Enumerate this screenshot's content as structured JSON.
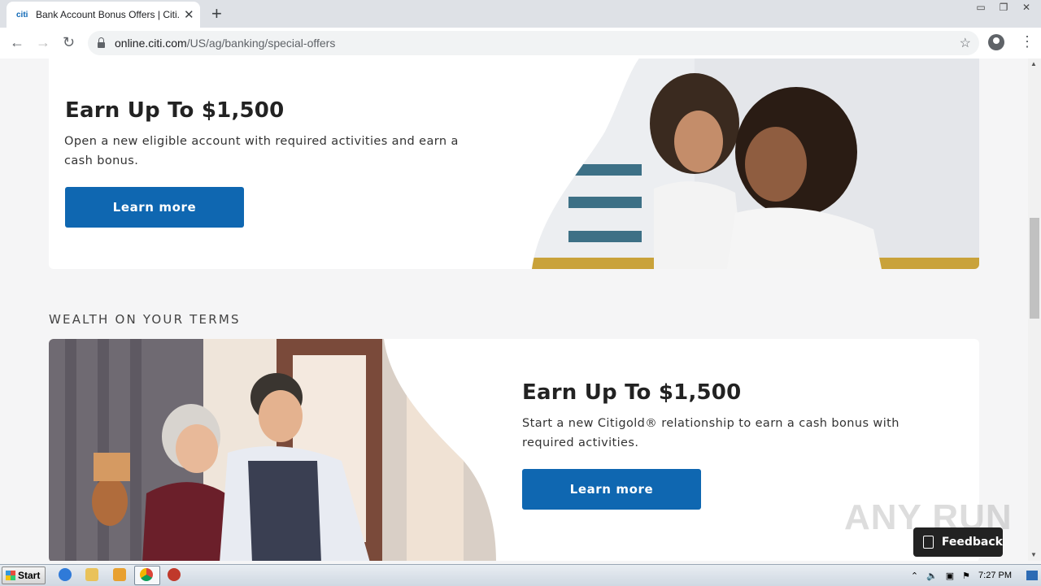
{
  "browser": {
    "tab_title": "Bank Account Bonus Offers | Citi.com",
    "favicon_text": "citi",
    "url_host": "online.citi.com",
    "url_path": "/US/ag/banking/special-offers"
  },
  "offers": [
    {
      "title": "Earn Up To $1,500",
      "description": "Open a new eligible account with required activities and earn a cash bonus.",
      "button_label": "Learn more"
    },
    {
      "title": "Earn Up To $1,500",
      "description": "Start a new Citigold® relationship to earn a cash bonus with required activities.",
      "button_label": "Learn more"
    }
  ],
  "section_label": "WEALTH ON YOUR TERMS",
  "feedback_label": "Feedback",
  "watermark_text": "ANY RUN",
  "taskbar": {
    "start_label": "Start",
    "clock": "7:27 PM"
  },
  "icons": [
    "citi-favicon",
    "close-icon",
    "new-tab-icon",
    "back-icon",
    "forward-icon",
    "reload-icon",
    "lock-icon",
    "star-icon",
    "profile-icon",
    "menu-icon",
    "thumbs-up-icon",
    "ie-icon",
    "folder-icon",
    "media-icon",
    "chrome-icon",
    "stop-icon"
  ],
  "colors": {
    "brand_blue": "#0f67b1",
    "page_bg": "#f5f5f6",
    "feedback_bg": "#222222"
  }
}
